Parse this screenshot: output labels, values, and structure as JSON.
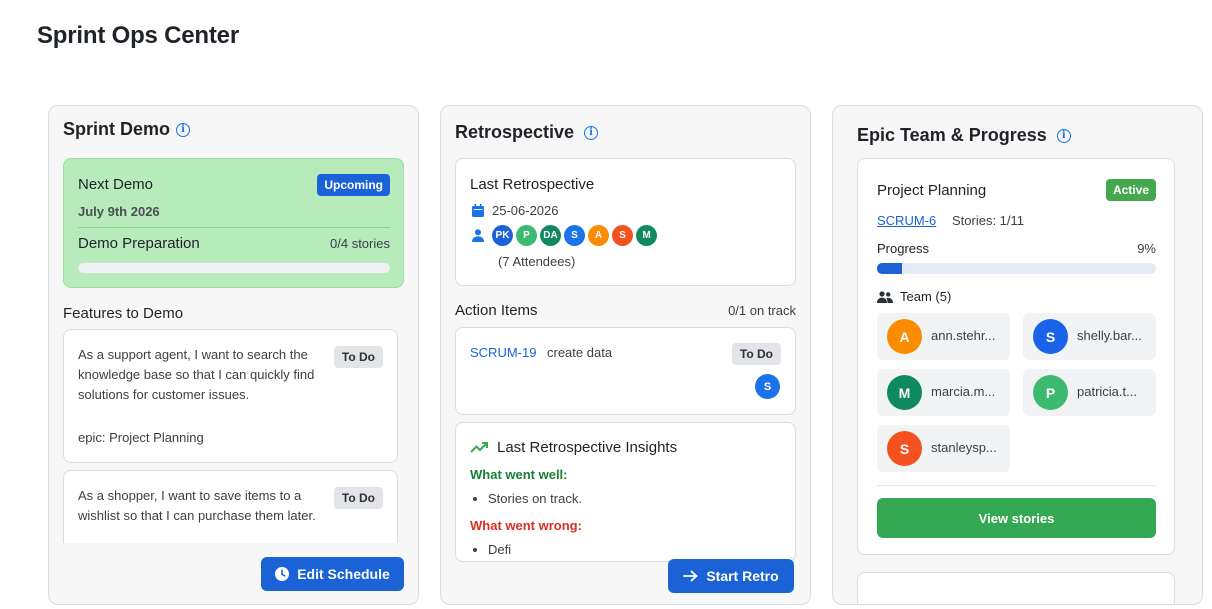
{
  "page": {
    "title": "Sprint Ops Center"
  },
  "colors": {
    "primary": "#1a62d6",
    "success": "#34a853",
    "demo_bg": "#b7ebbb",
    "danger": "#d93025",
    "good": "#188038"
  },
  "sprint_demo": {
    "title": "Sprint Demo",
    "next_demo_label": "Next Demo",
    "status_badge": "Upcoming",
    "date": "July 9th 2026",
    "prep_label": "Demo Preparation",
    "prep_count": "0/4 stories",
    "prep_progress": 0,
    "features_title": "Features to Demo",
    "features": [
      {
        "text": "As a support agent, I want to search the knowledge base so that I can quickly find solutions for customer issues.",
        "status": "To Do",
        "epic": "epic: Project Planning"
      },
      {
        "text": "As a shopper, I want to save items to a wishlist so that I can purchase them later.",
        "status": "To Do"
      }
    ],
    "edit_button": "Edit Schedule",
    "icons": {
      "info": "info-icon",
      "clock": "clock-icon"
    }
  },
  "retrospective": {
    "title": "Retrospective",
    "last_title": "Last Retrospective",
    "date": "25-06-2026",
    "attendees": [
      {
        "initials": "PK",
        "color": "#1a62d6"
      },
      {
        "initials": "P",
        "color": "#3cba6f"
      },
      {
        "initials": "DA",
        "color": "#0f8a5f"
      },
      {
        "initials": "S",
        "color": "#1a73e8"
      },
      {
        "initials": "A",
        "color": "#fb8c00"
      },
      {
        "initials": "S",
        "color": "#f4511e"
      },
      {
        "initials": "M",
        "color": "#0f8a5f"
      }
    ],
    "attendee_count": "(7 Attendees)",
    "action_items_title": "Action Items",
    "action_items_status": "0/1 on track",
    "action_item": {
      "key": "SCRUM-19",
      "text": "create data",
      "status": "To Do",
      "assignee": "S",
      "assignee_color": "#1a73e8"
    },
    "insights_title": "Last Retrospective Insights",
    "went_well_label": "What went well:",
    "went_well": [
      "Stories on track."
    ],
    "went_wrong_label": "What went wrong:",
    "went_wrong_partial": "Defi",
    "start_button": "Start Retro",
    "icons": {
      "calendar": "calendar-icon",
      "person": "person-icon",
      "trend": "trending-up-icon",
      "arrow": "arrow-right-icon"
    }
  },
  "epic": {
    "title": "Epic Team & Progress",
    "name": "Project Planning",
    "status": "Active",
    "key": "SCRUM-6",
    "stories": "Stories: 1/11",
    "progress_label": "Progress",
    "progress_text": "9%",
    "progress": 9,
    "team_label": "Team (5)",
    "members": [
      {
        "initial": "A",
        "name": "ann.stehr...",
        "color": "#fb8c00"
      },
      {
        "initial": "S",
        "name": "shelly.bar...",
        "color": "#1a62e8"
      },
      {
        "initial": "M",
        "name": "marcia.m...",
        "color": "#0f8a5f"
      },
      {
        "initial": "P",
        "name": "patricia.t...",
        "color": "#3cba6f"
      },
      {
        "initial": "S",
        "name": "stanleysp...",
        "color": "#f4511e"
      }
    ],
    "view_button": "View stories",
    "icons": {
      "team": "team-icon"
    }
  }
}
